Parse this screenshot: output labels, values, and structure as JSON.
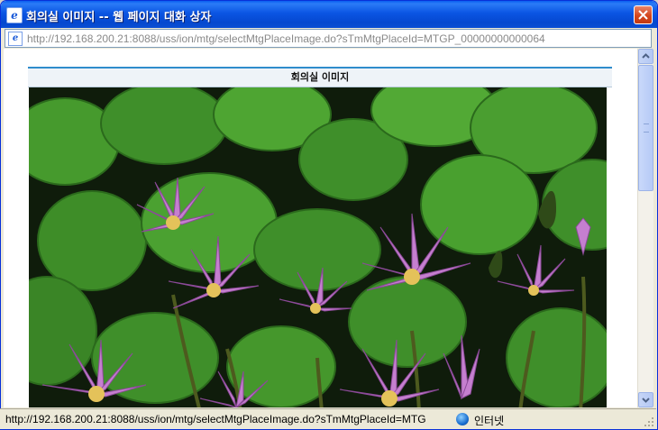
{
  "window": {
    "title": "회의실 이미지 -- 웹 페이지 대화 상자",
    "address_url": "http://192.168.200.21:8088/uss/ion/mtg/selectMtgPlaceImage.do?sTmMtgPlaceId=MTGP_00000000000064"
  },
  "content": {
    "section_title": "회의실 이미지"
  },
  "status": {
    "text": "http://192.168.200.21:8088/uss/ion/mtg/selectMtgPlaceImage.do?sTmMtgPlaceId=MTG",
    "zone": "인터넷"
  },
  "colors": {
    "titlebar": "#0b55e3",
    "close": "#d4461c",
    "header_accent": "#2f8ccc"
  },
  "icons": [
    "ie-page-icon",
    "close-icon",
    "globe-icon",
    "scroll-up-arrow-icon",
    "scroll-down-arrow-icon",
    "resize-grip-icon"
  ]
}
